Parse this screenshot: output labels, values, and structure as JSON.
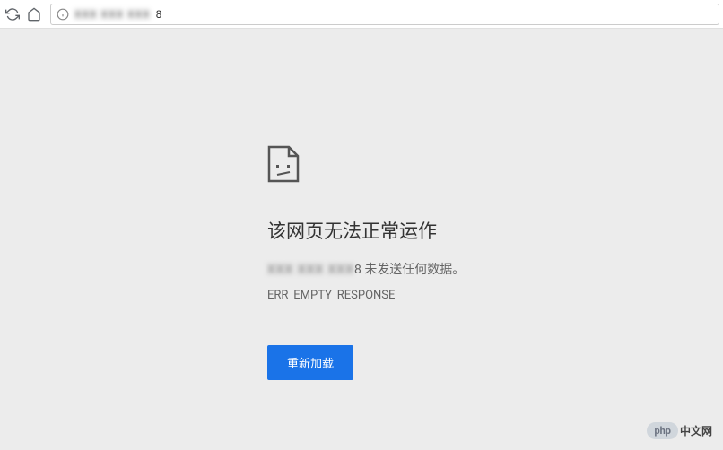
{
  "toolbar": {
    "address_blurred": "XXX XXX XXX",
    "address_suffix": "8"
  },
  "error": {
    "title": "该网页无法正常运作",
    "host_blurred": "XXX XXX XXX",
    "host_suffix": "8",
    "message": "未发送任何数据。",
    "code": "ERR_EMPTY_RESPONSE",
    "reload_label": "重新加载"
  },
  "watermark": {
    "badge": "php",
    "text": "中文网"
  }
}
